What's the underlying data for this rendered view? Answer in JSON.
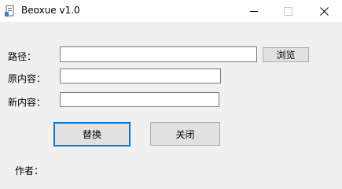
{
  "window": {
    "title": "Beoxue v1.0"
  },
  "form": {
    "path": {
      "label": "路径：",
      "value": ""
    },
    "browse_label": "浏览",
    "old_content": {
      "label": "原内容：",
      "value": ""
    },
    "new_content": {
      "label": "新内容：",
      "value": ""
    },
    "replace_label": "替换",
    "close_label": "关闭"
  },
  "footer": {
    "author": "作者："
  },
  "icons": {
    "app": "app-icon",
    "minimize": "minimize-icon",
    "maximize": "maximize-icon",
    "close": "close-icon"
  }
}
